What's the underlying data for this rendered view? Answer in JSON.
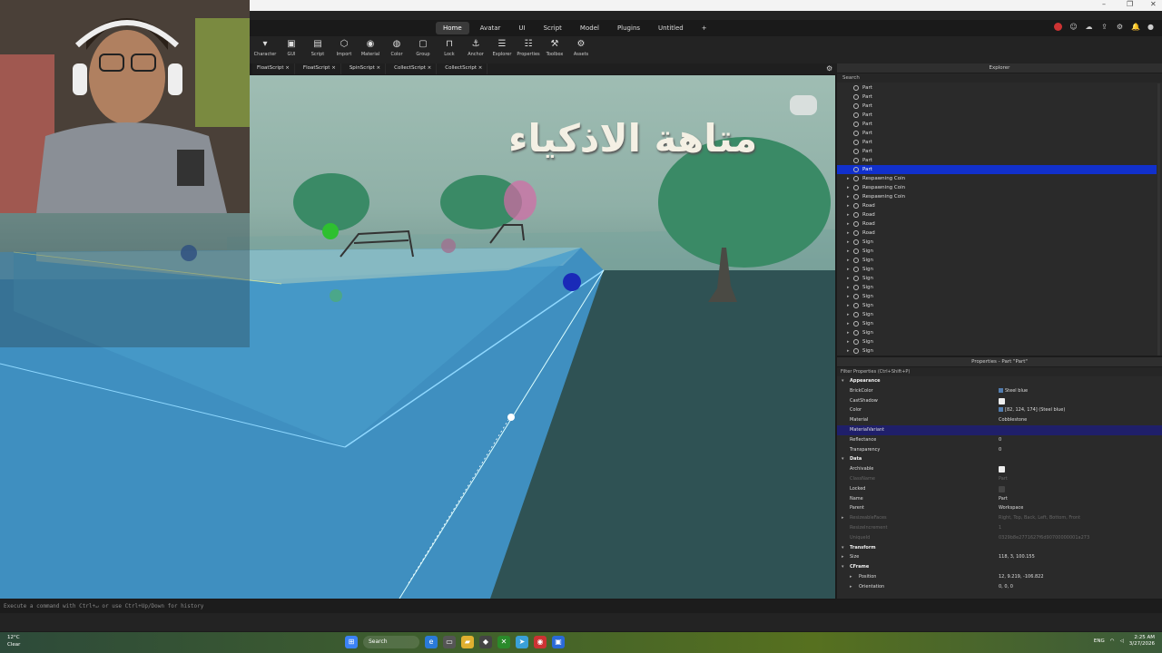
{
  "window": {
    "controls": [
      "–",
      "❐",
      "✕"
    ]
  },
  "ribbon": {
    "tabs": [
      "Home",
      "Avatar",
      "UI",
      "Script",
      "Model",
      "Plugins",
      "Untitled",
      "+"
    ],
    "active_tab": "Home",
    "tools": [
      {
        "icon": "character-icon",
        "glyph": "▾",
        "label": "Character"
      },
      {
        "icon": "gui-icon",
        "glyph": "▣",
        "label": "GUI"
      },
      {
        "icon": "script-icon",
        "glyph": "▤",
        "label": "Script"
      },
      {
        "icon": "import-icon",
        "glyph": "⬡",
        "label": "Import"
      },
      {
        "icon": "material-icon",
        "glyph": "◉",
        "label": "Material"
      },
      {
        "icon": "color-icon",
        "glyph": "◍",
        "label": "Color"
      },
      {
        "icon": "group-icon",
        "glyph": "▢",
        "label": "Group"
      },
      {
        "icon": "lock-icon",
        "glyph": "⊓",
        "label": "Lock"
      },
      {
        "icon": "anchor-icon",
        "glyph": "⚓",
        "label": "Anchor"
      },
      {
        "icon": "explorer-icon",
        "glyph": "☰",
        "label": "Explorer"
      },
      {
        "icon": "properties-icon",
        "glyph": "☷",
        "label": "Properties"
      },
      {
        "icon": "toolbox-icon",
        "glyph": "⚒",
        "label": "Toolbox"
      },
      {
        "icon": "assets-icon",
        "glyph": "⚙",
        "label": "Assets"
      }
    ]
  },
  "script_tabs": [
    "FloatScript ×",
    "FloatScript ×",
    "SpinScript ×",
    "CollectScript ×",
    "CollectScript ×"
  ],
  "viewport": {
    "sign_text": "متاهة الاذكياء"
  },
  "explorer": {
    "title": "Explorer",
    "search_placeholder": "Search",
    "rows": [
      {
        "label": "Part",
        "expand": false,
        "selected": false
      },
      {
        "label": "Part",
        "expand": false,
        "selected": false
      },
      {
        "label": "Part",
        "expand": false,
        "selected": false
      },
      {
        "label": "Part",
        "expand": false,
        "selected": false
      },
      {
        "label": "Part",
        "expand": false,
        "selected": false
      },
      {
        "label": "Part",
        "expand": false,
        "selected": false
      },
      {
        "label": "Part",
        "expand": false,
        "selected": false
      },
      {
        "label": "Part",
        "expand": false,
        "selected": false
      },
      {
        "label": "Part",
        "expand": false,
        "selected": false
      },
      {
        "label": "Part",
        "expand": false,
        "selected": true
      },
      {
        "label": "Respawning Coin",
        "expand": true,
        "selected": false
      },
      {
        "label": "Respawning Coin",
        "expand": true,
        "selected": false
      },
      {
        "label": "Respawning Coin",
        "expand": true,
        "selected": false
      },
      {
        "label": "Road",
        "expand": true,
        "selected": false
      },
      {
        "label": "Road",
        "expand": true,
        "selected": false
      },
      {
        "label": "Road",
        "expand": true,
        "selected": false
      },
      {
        "label": "Road",
        "expand": true,
        "selected": false
      },
      {
        "label": "Sign",
        "expand": true,
        "selected": false
      },
      {
        "label": "Sign",
        "expand": true,
        "selected": false
      },
      {
        "label": "Sign",
        "expand": true,
        "selected": false
      },
      {
        "label": "Sign",
        "expand": true,
        "selected": false
      },
      {
        "label": "Sign",
        "expand": true,
        "selected": false
      },
      {
        "label": "Sign",
        "expand": true,
        "selected": false
      },
      {
        "label": "Sign",
        "expand": true,
        "selected": false
      },
      {
        "label": "Sign",
        "expand": true,
        "selected": false
      },
      {
        "label": "Sign",
        "expand": true,
        "selected": false
      },
      {
        "label": "Sign",
        "expand": true,
        "selected": false
      },
      {
        "label": "Sign",
        "expand": true,
        "selected": false
      },
      {
        "label": "Sign",
        "expand": true,
        "selected": false
      },
      {
        "label": "Sign",
        "expand": true,
        "selected": false
      }
    ]
  },
  "properties": {
    "title": "Properties - Part \"Part\"",
    "filter_placeholder": "Filter Properties (Ctrl+Shift+P)",
    "rows": [
      {
        "kind": "section",
        "name": "Appearance"
      },
      {
        "kind": "text",
        "name": "BrickColor",
        "value": "Steel blue",
        "swatch": true
      },
      {
        "kind": "check",
        "name": "CastShadow",
        "checked": true
      },
      {
        "kind": "text",
        "name": "Color",
        "value": "[82, 124, 174] (Steel blue)",
        "swatch": true
      },
      {
        "kind": "text",
        "name": "Material",
        "value": "Cobblestone"
      },
      {
        "kind": "text",
        "name": "MaterialVariant",
        "value": "",
        "highlight": true
      },
      {
        "kind": "text",
        "name": "Reflectance",
        "value": "0"
      },
      {
        "kind": "text",
        "name": "Transparency",
        "value": "0"
      },
      {
        "kind": "section",
        "name": "Data"
      },
      {
        "kind": "check",
        "name": "Archivable",
        "checked": true
      },
      {
        "kind": "text",
        "name": "ClassName",
        "value": "Part",
        "dim": true
      },
      {
        "kind": "check",
        "name": "Locked",
        "checked": false
      },
      {
        "kind": "text",
        "name": "Name",
        "value": "Part"
      },
      {
        "kind": "text",
        "name": "Parent",
        "value": "Workspace"
      },
      {
        "kind": "text",
        "name": "ResizeableFaces",
        "value": "Right, Top, Back, Left, Bottom, Front",
        "dim": true,
        "expand": true
      },
      {
        "kind": "text",
        "name": "ResizeIncrement",
        "value": "1",
        "dim": true
      },
      {
        "kind": "text",
        "name": "UniqueId",
        "value": "0329b8e2771627f6d90700000001a273",
        "dim": true
      },
      {
        "kind": "section",
        "name": "Transform"
      },
      {
        "kind": "text",
        "name": "Size",
        "value": "118, 3, 100.155",
        "expand": true
      },
      {
        "kind": "subsection",
        "name": "CFrame"
      },
      {
        "kind": "text",
        "name": "Position",
        "value": "12, 9.219, -106.822",
        "expand": true,
        "indent": true
      },
      {
        "kind": "text",
        "name": "Orientation",
        "value": "0, 0, 0",
        "expand": true,
        "indent": true
      }
    ]
  },
  "command_bar": {
    "placeholder": "Execute a command with Ctrl+↵ or use Ctrl+Up/Down for history"
  },
  "taskbar": {
    "weather_temp": "12°C",
    "weather_desc": "Clear",
    "search_label": "Search",
    "lang": "ENG",
    "time": "2:25 AM",
    "date": "3/27/2026"
  }
}
